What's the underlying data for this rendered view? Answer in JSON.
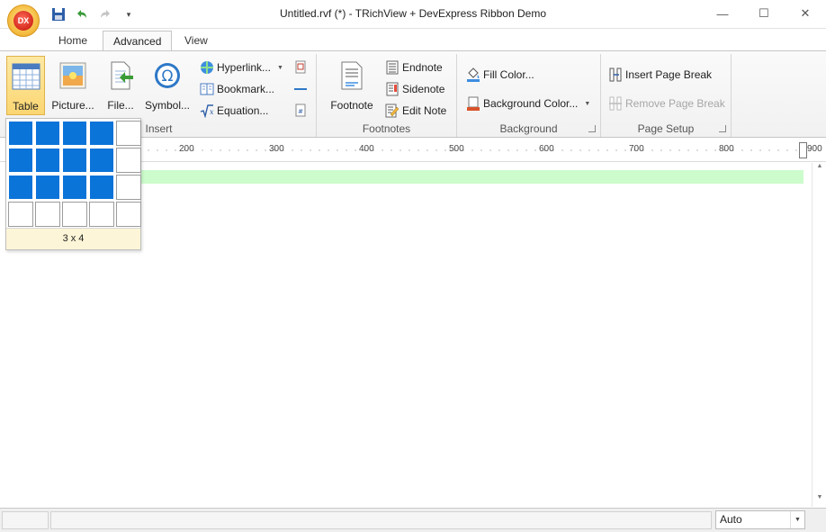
{
  "window": {
    "title": "Untitled.rvf (*) - TRichView + DevExpress Ribbon Demo",
    "logo_text": "DX",
    "minimize_glyph": "—",
    "maximize_glyph": "☐",
    "close_glyph": "✕"
  },
  "quick_access": {
    "customize_glyph": "▾"
  },
  "tabs": [
    {
      "label": "Home",
      "active": false
    },
    {
      "label": "Advanced",
      "active": true
    },
    {
      "label": "View",
      "active": false
    }
  ],
  "ribbon": {
    "insert": {
      "caption": "Insert",
      "table_label": "Table",
      "picture_label": "Picture...",
      "file_label": "File...",
      "symbol_label": "Symbol...",
      "hyperlink_label": "Hyperlink...",
      "bookmark_label": "Bookmark...",
      "equation_label": "Equation..."
    },
    "footnotes": {
      "caption": "Footnotes",
      "footnote_label": "Footnote",
      "endnote_label": "Endnote",
      "sidenote_label": "Sidenote",
      "edit_note_label": "Edit Note"
    },
    "background": {
      "caption": "Background",
      "fill_color_label": "Fill Color...",
      "background_color_label": "Background Color..."
    },
    "page_setup": {
      "caption": "Page Setup",
      "insert_page_break_label": "Insert Page Break",
      "remove_page_break_label": "Remove Page Break"
    }
  },
  "table_popup": {
    "rows": 4,
    "cols": 5,
    "selected_rows": 3,
    "selected_cols": 4,
    "caption": "3 x 4"
  },
  "ruler": {
    "ticks": [
      "200",
      "300",
      "400",
      "500",
      "600",
      "700",
      "800",
      "900"
    ]
  },
  "status": {
    "zoom_value": "Auto"
  },
  "colors": {
    "accent": "#0b74d9",
    "highlight": "#ccfccc",
    "pressed": "#fbd672"
  }
}
